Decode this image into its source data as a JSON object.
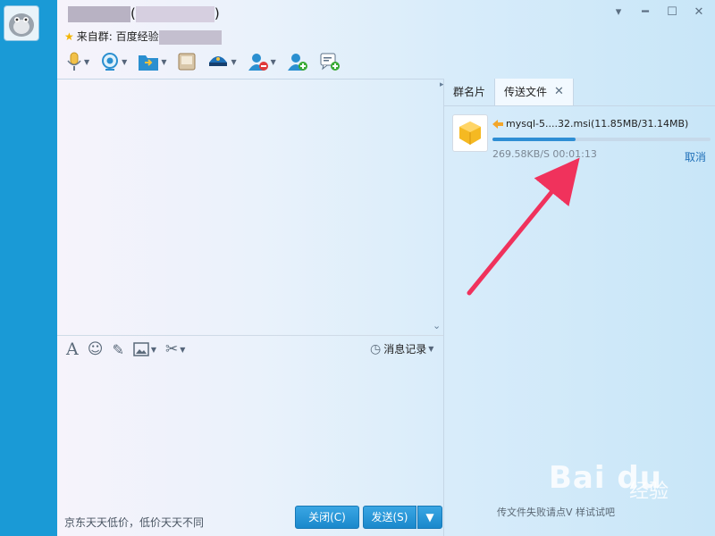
{
  "window": {
    "title_open": "(",
    "title_close": ")",
    "subtitle_prefix": "来自群:",
    "subtitle_group": "百度经验",
    "controls": [
      "minimize",
      "maximize",
      "close"
    ]
  },
  "toolbar": {
    "icons": [
      "microphone-icon",
      "camera-icon",
      "folder-icon",
      "screen-share-icon",
      "app-icon",
      "remove-user-icon",
      "add-user-icon",
      "message-add-icon"
    ]
  },
  "input_toolbar": {
    "history_label": "消息记录"
  },
  "footer": {
    "ad_text": "京东天天低价，低价天天不同",
    "close_label": "关闭(C)",
    "send_label": "发送(S)"
  },
  "panel": {
    "tabs": [
      "群名片",
      "传送文件"
    ],
    "transfer": {
      "file_name": "mysql-5....32.msi(11.85MB/31.14MB)",
      "speed": "269.58KB/S 00:01:13",
      "progress": 0.38,
      "cancel_label": "取消"
    },
    "footer_hint": "传文件失败请点V    样试试吧"
  },
  "watermark": {
    "brand": "Bai du",
    "suffix": "经验"
  },
  "colors": {
    "accent": "#1a9ad6",
    "annotation_arrow": "#f0325c"
  }
}
